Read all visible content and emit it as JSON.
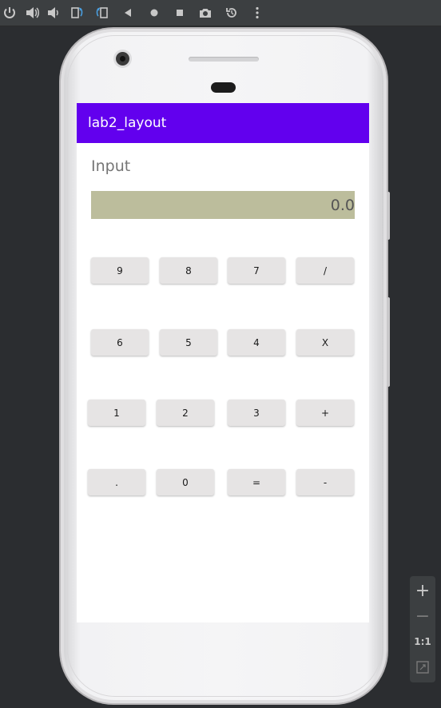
{
  "toolbar": {
    "icons": [
      "power-icon",
      "volume-up-icon",
      "volume-down-icon",
      "rotate-left-icon",
      "rotate-right-icon",
      "back-icon",
      "home-icon",
      "overview-icon",
      "camera-icon",
      "replay-icon",
      "more-icon"
    ]
  },
  "app": {
    "title": "lab2_layout",
    "accent": "#6200ee"
  },
  "input": {
    "label": "Input",
    "display_value": "0.0",
    "display_bg": "#bcbd9c"
  },
  "keypad": {
    "rows": [
      [
        "9",
        "8",
        "7",
        "/"
      ],
      [
        "6",
        "5",
        "4",
        "X"
      ],
      [
        "1",
        "2",
        "3",
        "+"
      ],
      [
        ".",
        "0",
        "=",
        "-"
      ]
    ]
  },
  "zoom": {
    "zoom_in": "+",
    "zoom_out": "−",
    "actual_size": "1:1"
  }
}
